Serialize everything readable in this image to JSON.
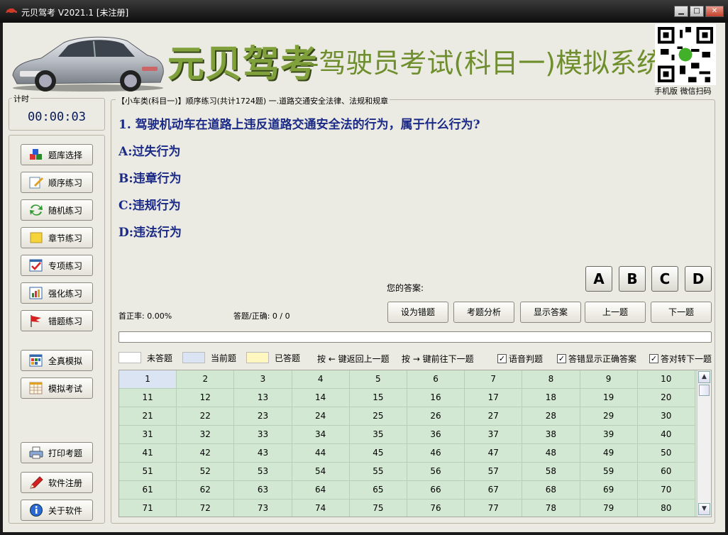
{
  "window": {
    "title": "元贝驾考 V2021.1 [未注册]"
  },
  "banner": {
    "logo": "元贝驾考",
    "slogan": "--驾驶员考试(科目一)模拟系统",
    "qr_caption": "手机版 微信扫码"
  },
  "timer": {
    "label": "计时",
    "value": "00:00:03"
  },
  "left_buttons": [
    {
      "label": "题库选择",
      "icon": "cubes-icon"
    },
    {
      "label": "顺序练习",
      "icon": "edit-icon"
    },
    {
      "label": "随机练习",
      "icon": "shuffle-icon"
    },
    {
      "label": "章节练习",
      "icon": "folder-icon"
    },
    {
      "label": "专项练习",
      "icon": "checklist-icon"
    },
    {
      "label": "强化练习",
      "icon": "bar-chart-icon"
    },
    {
      "label": "错题练习",
      "icon": "flag-icon"
    },
    {
      "label": "全真模拟",
      "icon": "grid-icon"
    },
    {
      "label": "模拟考试",
      "icon": "table-icon"
    },
    {
      "label": "打印考题",
      "icon": "printer-icon"
    },
    {
      "label": "软件注册",
      "icon": "pen-icon"
    },
    {
      "label": "关于软件",
      "icon": "info-icon"
    }
  ],
  "question": {
    "header": "【小车类(科目一)】顺序练习(共计1724题) 一.道路交通安全法律、法规和规章",
    "text": "1. 驾驶机动车在道路上违反道路交通安全法的行为，属于什么行为?",
    "options": [
      "A:过失行为",
      "B:违章行为",
      "C:违规行为",
      "D:违法行为"
    ]
  },
  "answer": {
    "label": "您的答案:",
    "choices": [
      "A",
      "B",
      "C",
      "D"
    ]
  },
  "stats": {
    "first_rate": "首正率: 0.00%",
    "answered": "答题/正确: 0 / 0"
  },
  "actions": [
    "设为错题",
    "考题分析",
    "显示答案",
    "上一题",
    "下一题"
  ],
  "progress": 0,
  "legend": {
    "unanswered": "未答题",
    "current": "当前题",
    "answered": "已答题",
    "hint_prev": "按 ← 键返回上一题",
    "hint_next": "按 → 键前往下一题",
    "checks": [
      {
        "label": "语音判题",
        "checked": true
      },
      {
        "label": "答错显示正确答案",
        "checked": true
      },
      {
        "label": "答对转下一题",
        "checked": true
      }
    ]
  },
  "colors": {
    "unanswered": "#ffffff",
    "current": "#dbe4f3",
    "answered": "#fff6c0"
  },
  "grid": {
    "rows": [
      [
        "1",
        "2",
        "3",
        "4",
        "5",
        "6",
        "7",
        "8",
        "9",
        "10"
      ],
      [
        "11",
        "12",
        "13",
        "14",
        "15",
        "16",
        "17",
        "18",
        "19",
        "20"
      ],
      [
        "21",
        "22",
        "23",
        "24",
        "25",
        "26",
        "27",
        "28",
        "29",
        "30"
      ],
      [
        "31",
        "32",
        "33",
        "34",
        "35",
        "36",
        "37",
        "38",
        "39",
        "40"
      ],
      [
        "41",
        "42",
        "43",
        "44",
        "45",
        "46",
        "47",
        "48",
        "49",
        "50"
      ],
      [
        "51",
        "52",
        "53",
        "54",
        "55",
        "56",
        "57",
        "58",
        "59",
        "60"
      ],
      [
        "61",
        "62",
        "63",
        "64",
        "65",
        "66",
        "67",
        "68",
        "69",
        "70"
      ],
      [
        "71",
        "72",
        "73",
        "74",
        "75",
        "76",
        "77",
        "78",
        "79",
        "80"
      ]
    ],
    "current": "1"
  }
}
